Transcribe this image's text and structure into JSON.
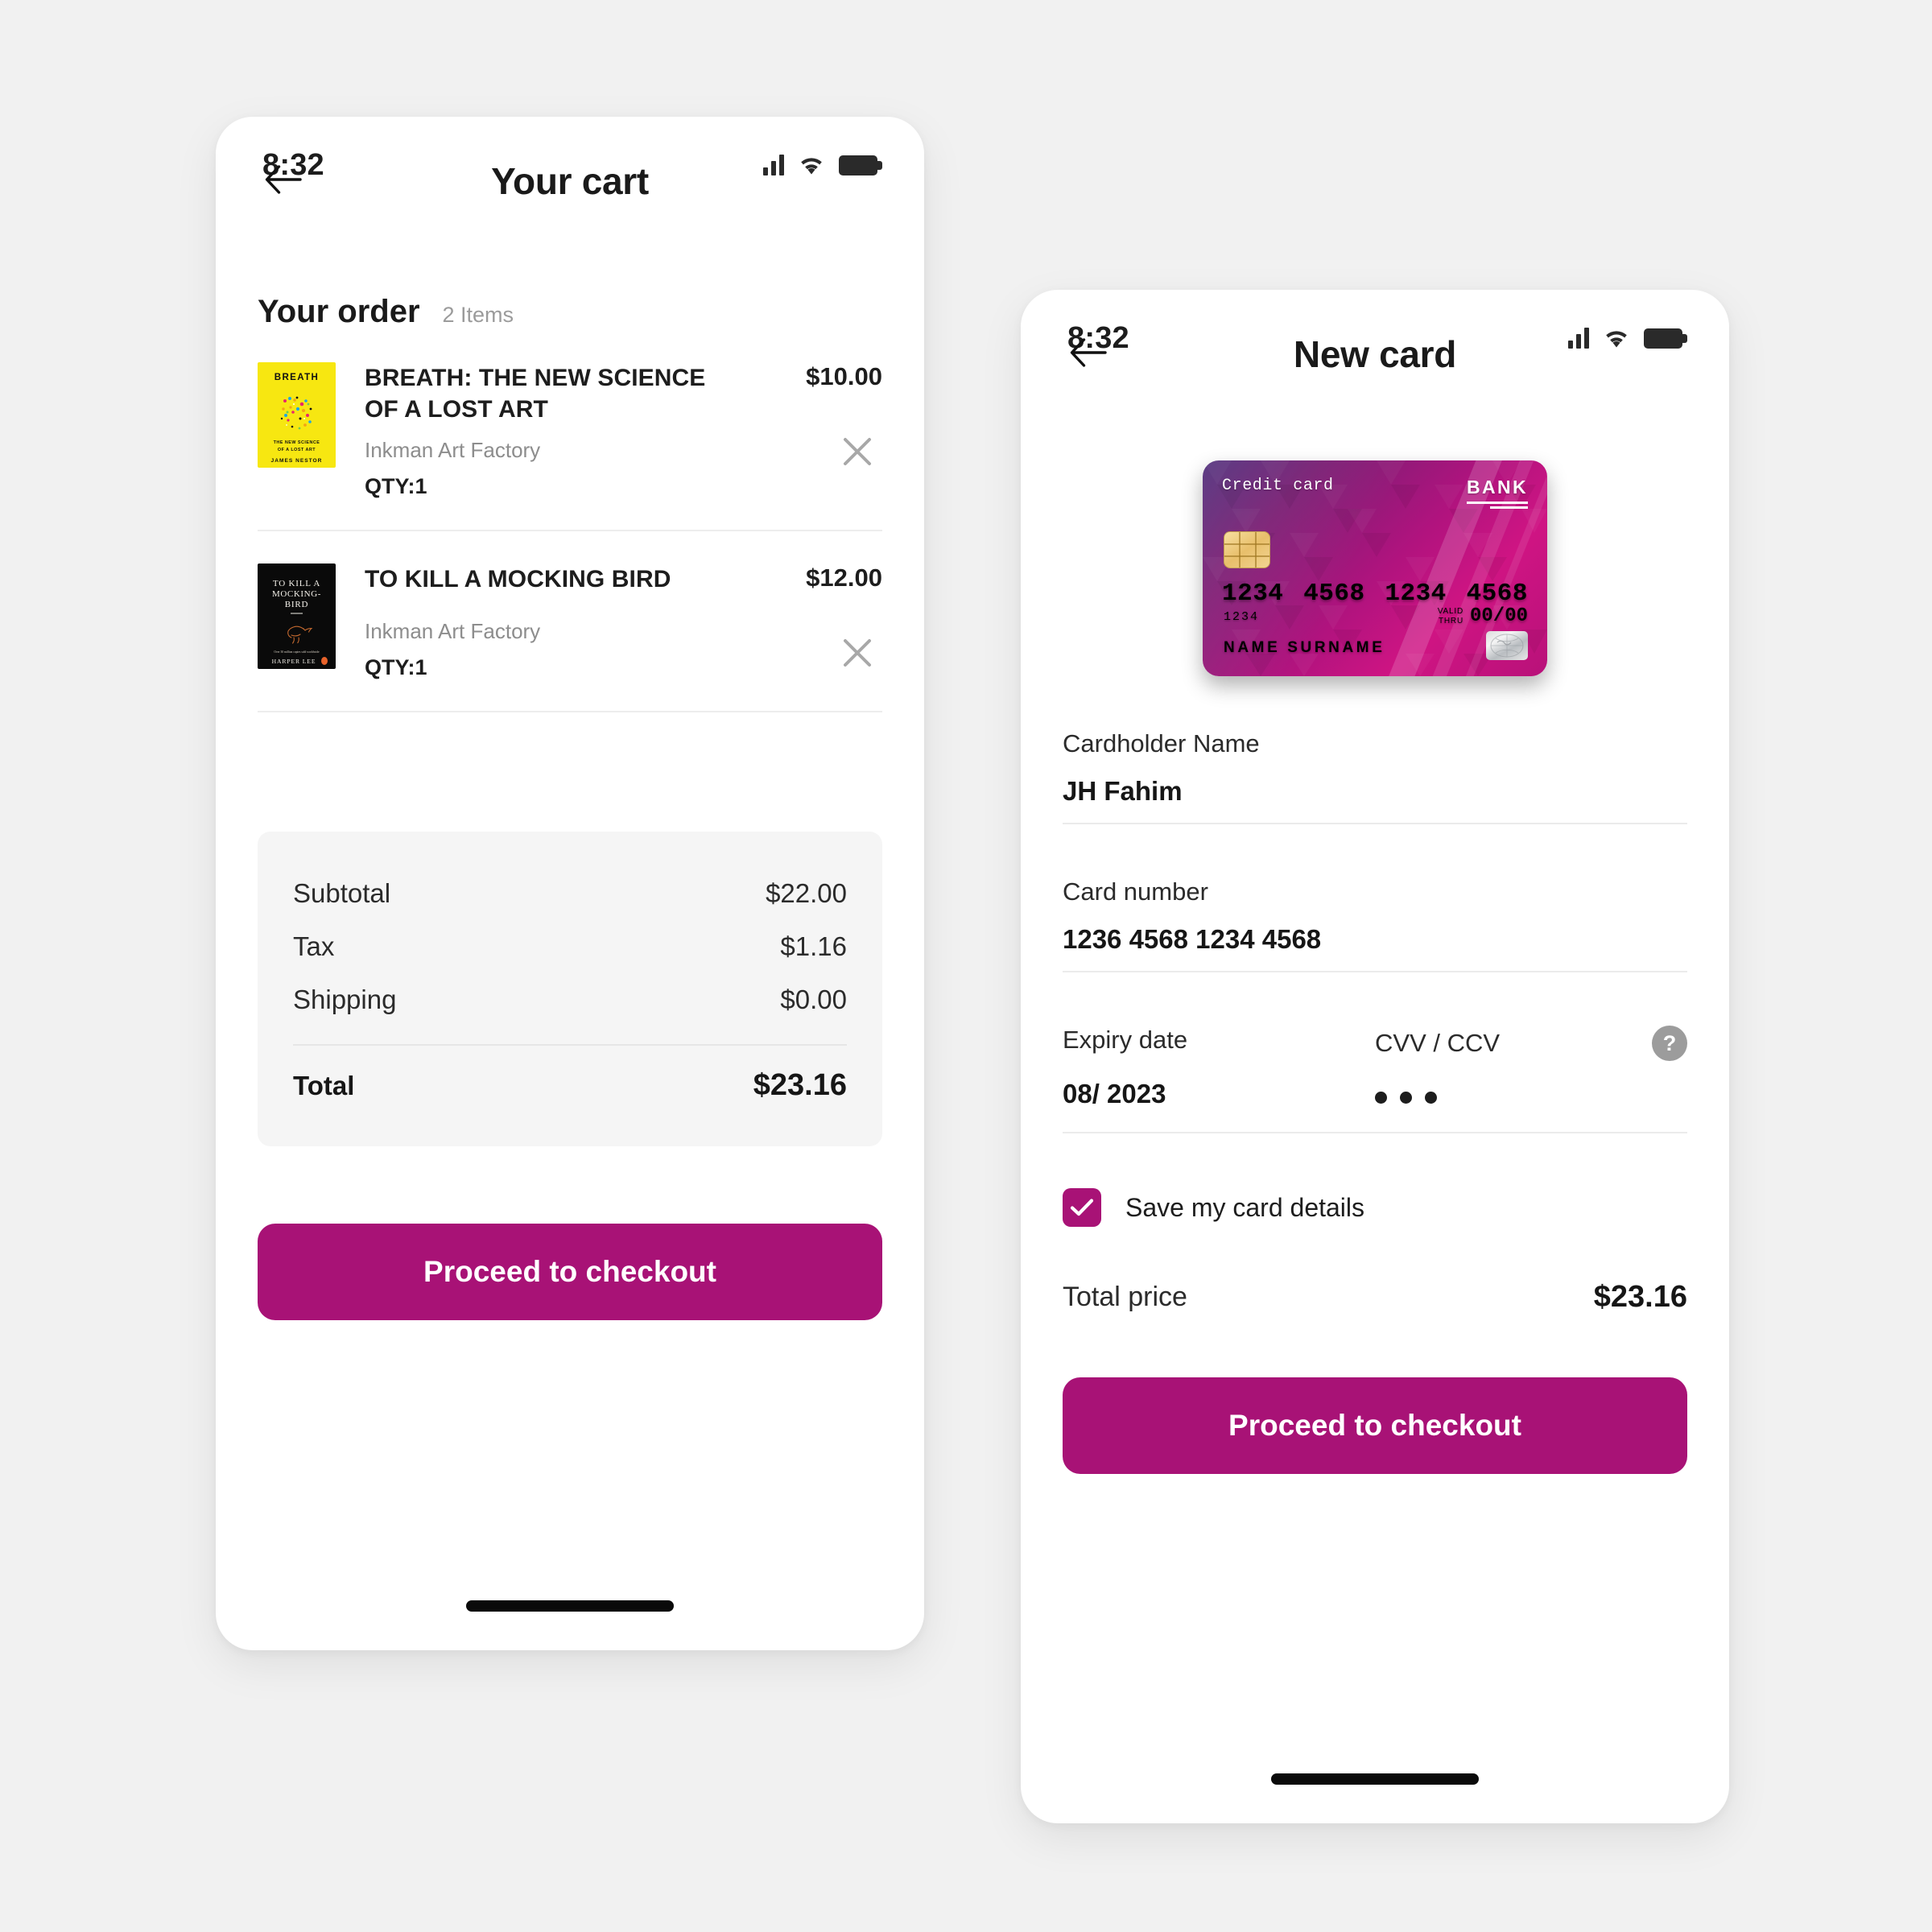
{
  "theme": {
    "accent": "#a81276",
    "background": "#f1f1f1",
    "surface": "#ffffff",
    "summary_surface": "#f5f5f5",
    "muted_text": "#8d8d8d",
    "divider": "#ededed"
  },
  "cart_screen": {
    "status": {
      "time": "8:32",
      "signal_icon": "signal-bars-icon",
      "wifi_icon": "wifi-icon",
      "battery_icon": "battery-full-icon"
    },
    "nav": {
      "back_icon": "arrow-left-icon",
      "title": "Your cart"
    },
    "order": {
      "heading": "Your order",
      "count": "2 Items",
      "items": [
        {
          "title": "BREATH: THE NEW SCIENCE OF A LOST ART",
          "vendor": "Inkman Art Factory",
          "qty": "QTY:1",
          "price": "$10.00",
          "remove_icon": "close-icon",
          "cover": {
            "kind": "breath-book-cover",
            "bg": "#f7e711",
            "title_text": "BREATH",
            "sub1": "THE NEW SCIENCE",
            "sub2": "OF A LOST ART",
            "author": "JAMES NESTOR"
          }
        },
        {
          "title": "TO KILL A MOCKING BIRD",
          "vendor": "Inkman Art Factory",
          "qty": "QTY:1",
          "price": "$12.00",
          "remove_icon": "close-icon",
          "cover": {
            "kind": "mockingbird-book-cover",
            "bg": "#0a0a0a",
            "line1": "TO KILL A",
            "line2": "MOCKING-",
            "line3": "BIRD",
            "tagline": "Over 30 million copies sold worldwide",
            "author": "HARPER LEE"
          }
        }
      ]
    },
    "summary": {
      "rows": [
        {
          "label": "Subtotal",
          "value": "$22.00"
        },
        {
          "label": "Tax",
          "value": "$1.16"
        },
        {
          "label": "Shipping",
          "value": "$0.00"
        }
      ],
      "total_label": "Total",
      "total_value": "$23.16"
    },
    "cta": "Proceed to checkout"
  },
  "card_screen": {
    "status": {
      "time": "8:32",
      "signal_icon": "signal-bars-icon",
      "wifi_icon": "wifi-icon",
      "battery_icon": "battery-full-icon"
    },
    "nav": {
      "back_icon": "arrow-left-icon",
      "title": "New card"
    },
    "credit_card": {
      "type_label": "Credit card",
      "bank_label": "BANK",
      "number_groups": [
        "1234",
        "4568",
        "1234",
        "4568"
      ],
      "last_four_small": "1234",
      "valid_thru_label_line1": "VALID",
      "valid_thru_label_line2": "THRU",
      "valid_thru_value": "00/00",
      "name_label": "NAME SURNAME",
      "chip_icon": "emv-chip-icon",
      "hologram_icon": "hologram-globe-icon"
    },
    "form": {
      "cardholder_label": "Cardholder Name",
      "cardholder_value": "JH Fahim",
      "cardnumber_label": "Card number",
      "cardnumber_value": "1236  4568  1234  4568",
      "expiry_label": "Expiry date",
      "expiry_value": "08/ 2023",
      "cvv_label": "CVV / CCV",
      "cvv_masked": "•••",
      "help_icon": "question-mark-icon",
      "help_glyph": "?",
      "save_label": "Save my card details",
      "save_checked": true,
      "check_icon": "checkmark-icon"
    },
    "total": {
      "label": "Total price",
      "value": "$23.16"
    },
    "cta": "Proceed to checkout"
  }
}
